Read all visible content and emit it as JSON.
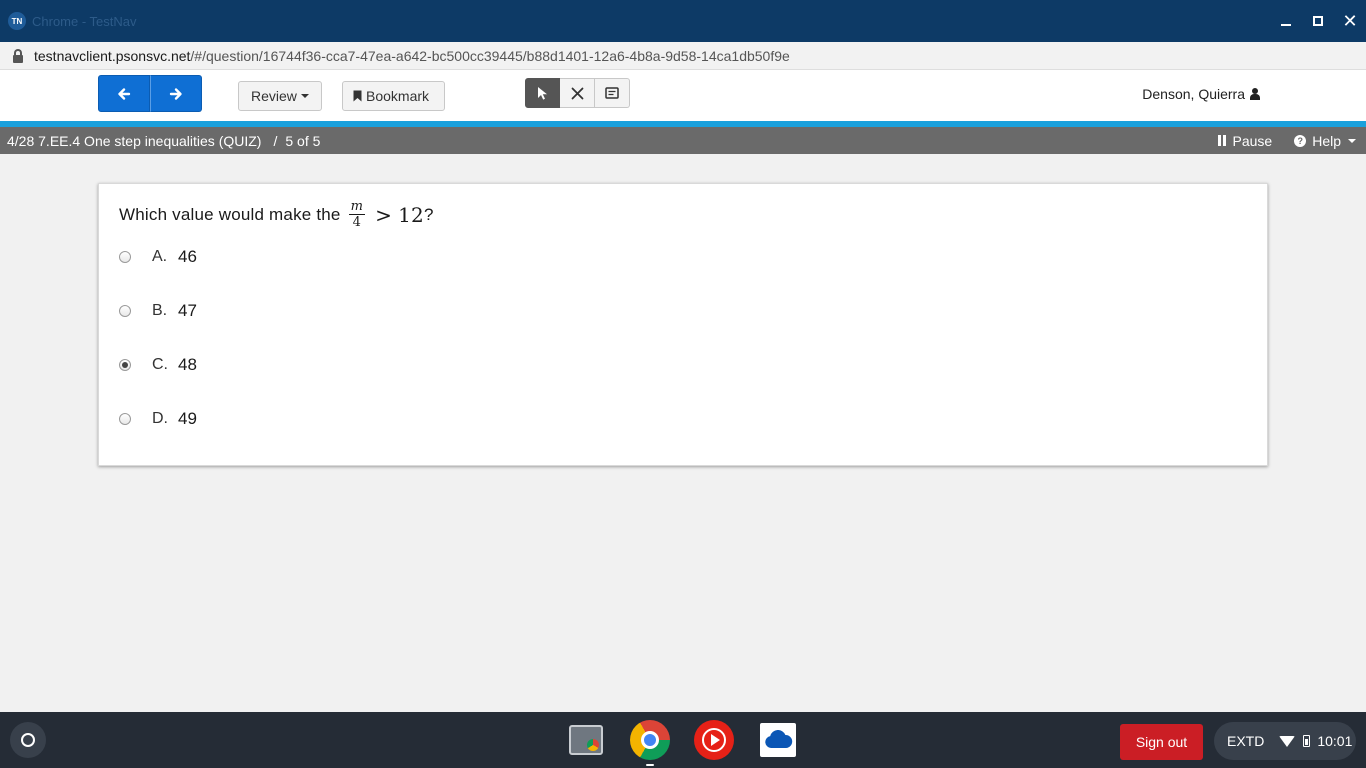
{
  "window": {
    "app_badge": "TN",
    "title": "Chrome - TestNav"
  },
  "address": {
    "host": "testnavclient.psonsvc.net",
    "path": "/#/question/16744f36-cca7-47ea-a642-bc500cc39445/b88d1401-12a6-4b8a-9d58-14ca1db50f9e"
  },
  "toolbar": {
    "review_label": "Review",
    "bookmark_label": "Bookmark",
    "user_name": "Denson, Quierra"
  },
  "info": {
    "quiz_title": "4/28 7.EE.4 One step inequalities (QUIZ)",
    "separator": "/",
    "progress": "5 of 5",
    "pause_label": "Pause",
    "help_label": "Help"
  },
  "question": {
    "prompt": "Which value would make the",
    "numerator": "m",
    "denominator": "4",
    "operator": ">",
    "rhs": "12",
    "end": "?",
    "choices": [
      {
        "letter": "A.",
        "value": "46",
        "selected": false
      },
      {
        "letter": "B.",
        "value": "47",
        "selected": false
      },
      {
        "letter": "C.",
        "value": "48",
        "selected": true
      },
      {
        "letter": "D.",
        "value": "49",
        "selected": false
      }
    ]
  },
  "shelf": {
    "sign_out_label": "Sign out",
    "tray_label": "EXTD",
    "time": "10:01"
  },
  "colors": {
    "title_bar": "#0d3a66",
    "nav_blue": "#0f6fd4",
    "accent_line": "#1aa0dc",
    "info_bar": "#6a6a6a",
    "sign_out": "#cb1e25"
  }
}
